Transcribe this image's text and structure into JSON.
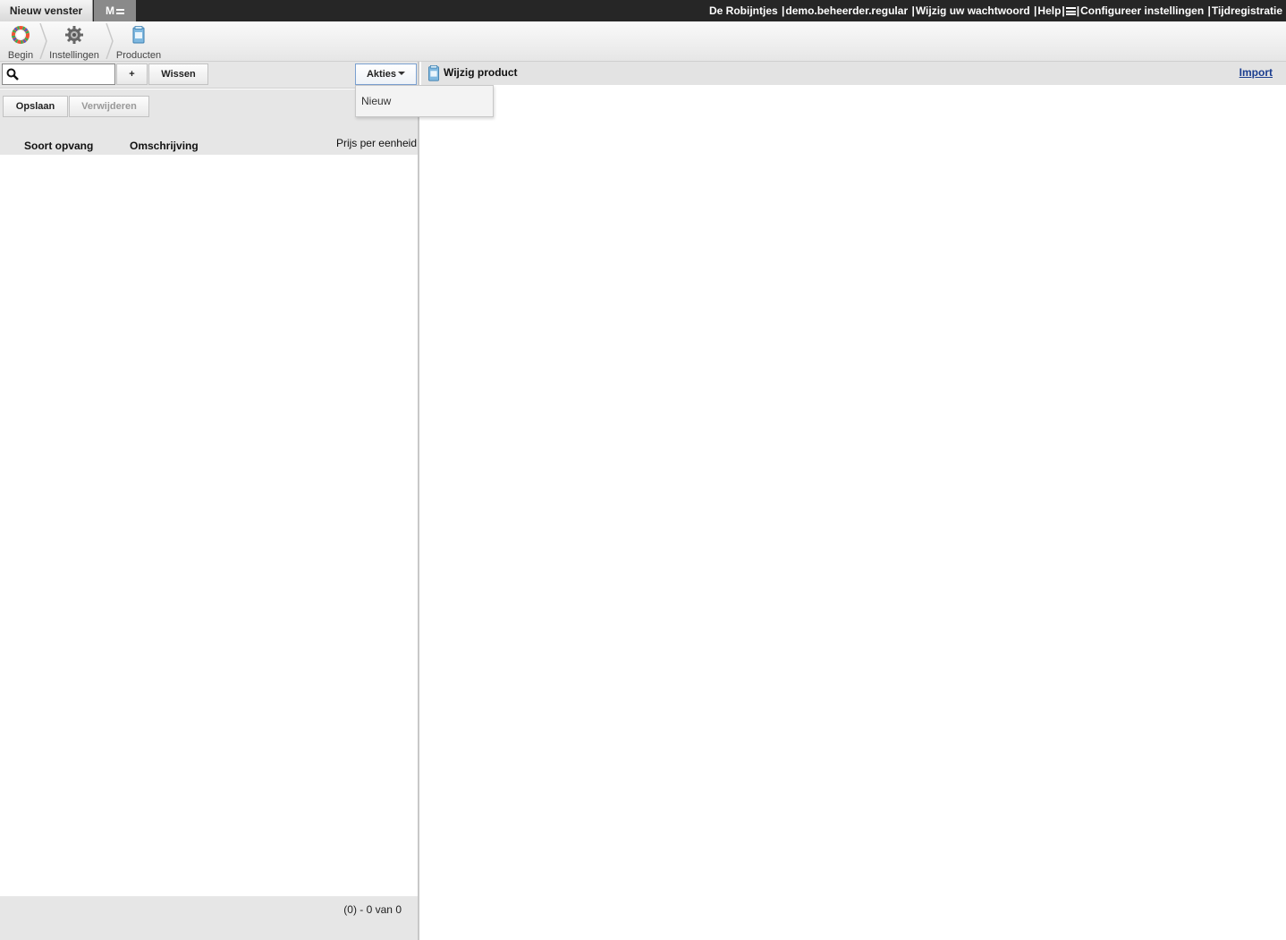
{
  "window": {
    "tab_new": "Nieuw venster",
    "tab_m": "M"
  },
  "toplinks": {
    "org": "De Robijntjes",
    "user": "demo.beheerder.regular",
    "change_password": "Wijzig uw wachtwoord",
    "help": "Help",
    "configure": "Configureer instellingen",
    "time_registration": "Tijdregistratie",
    "separator": "|"
  },
  "breadcrumb": {
    "items": [
      {
        "label": "Begin",
        "icon": "rainbow-ring-icon"
      },
      {
        "label": "Instellingen",
        "icon": "gear-icon"
      },
      {
        "label": "Producten",
        "icon": "product-box-icon"
      }
    ]
  },
  "left_toolbar": {
    "search_value": "",
    "add_label": "+",
    "clear_label": "Wissen",
    "actions_label": "Akties",
    "save_label": "Opslaan",
    "delete_label": "Verwijderen"
  },
  "actions_menu": {
    "items": [
      "Nieuw"
    ]
  },
  "table": {
    "columns": [
      "Soort opvang",
      "Omschrijving",
      "Prijs per eenheid"
    ],
    "rows": []
  },
  "pager": {
    "text": "(0) - 0 van 0"
  },
  "right_panel": {
    "title": "Wijzig product",
    "import_label": "Import"
  },
  "colors": {
    "topbar": "#262626",
    "panel_gray": "#e6e6e6",
    "link_blue": "#1a3d8f"
  }
}
